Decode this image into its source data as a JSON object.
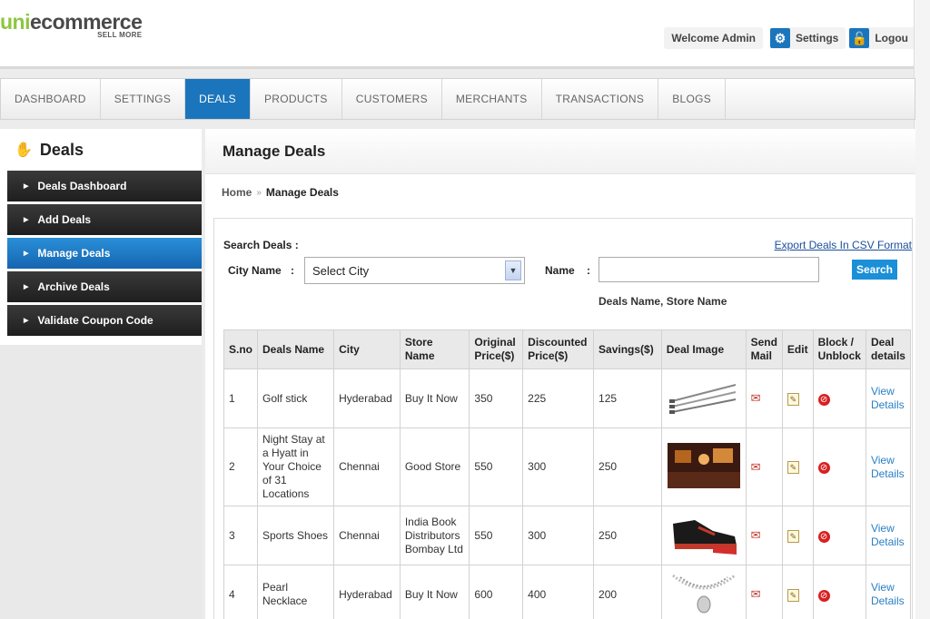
{
  "header": {
    "logo_uni": "uni",
    "logo_ecommerce": "ecommerce",
    "logo_tagline": "SELL MORE",
    "welcome": "Welcome Admin",
    "settings_label": "Settings",
    "logout_label": "Logou"
  },
  "nav": {
    "items": [
      "DASHBOARD",
      "SETTINGS",
      "DEALS",
      "PRODUCTS",
      "CUSTOMERS",
      "MERCHANTS",
      "TRANSACTIONS",
      "BLOGS"
    ],
    "active": "DEALS"
  },
  "sidebar": {
    "title": "Deals",
    "items": [
      "Deals Dashboard",
      "Add Deals",
      "Manage Deals",
      "Archive Deals",
      "Validate Coupon Code"
    ],
    "active": "Manage Deals"
  },
  "main": {
    "title": "Manage Deals",
    "breadcrumb": {
      "home": "Home",
      "current": "Manage Deals"
    },
    "search": {
      "label": "Search Deals :",
      "export_link": "Export Deals In CSV Format",
      "city_label": "City Name",
      "city_colon": ":",
      "city_selected": "Select City",
      "name_label": "Name",
      "name_colon": ":",
      "name_value": "",
      "button": "Search",
      "hint": "Deals Name, Store Name"
    },
    "table": {
      "headers": {
        "sno": "S.no",
        "name": "Deals Name",
        "city": "City",
        "store": "Store Name",
        "orig": "Original Price($)",
        "disc": "Discounted Price($)",
        "savings": "Savings($)",
        "image": "Deal Image",
        "mail": "Send Mail",
        "edit": "Edit",
        "block": "Block / Unblock",
        "details": "Deal details"
      },
      "rows": [
        {
          "sno": "1",
          "name": "Golf stick",
          "city": "Hyderabad",
          "store": "Buy It Now",
          "orig": "350",
          "disc": "225",
          "savings": "125",
          "image": "golf-sticks",
          "details": "View Details"
        },
        {
          "sno": "2",
          "name": "Night Stay at a Hyatt in Your Choice of 31 Locations",
          "city": "Chennai",
          "store": "Good Store",
          "orig": "550",
          "disc": "300",
          "savings": "250",
          "image": "hotel-room",
          "details": "View Details"
        },
        {
          "sno": "3",
          "name": "Sports Shoes",
          "city": "Chennai",
          "store": "India Book Distributors Bombay Ltd",
          "orig": "550",
          "disc": "300",
          "savings": "250",
          "image": "sports-shoe",
          "details": "View Details"
        },
        {
          "sno": "4",
          "name": "Pearl Necklace",
          "city": "Hyderabad",
          "store": "Buy It Now",
          "orig": "600",
          "disc": "400",
          "savings": "200",
          "image": "pearl-necklace",
          "details": "View Details"
        }
      ]
    }
  },
  "colors": {
    "accent": "#1b75bc",
    "sidebar_dark": "#2a2a2a",
    "link": "#2a7fc4",
    "logo_green": "#8cc63f"
  }
}
